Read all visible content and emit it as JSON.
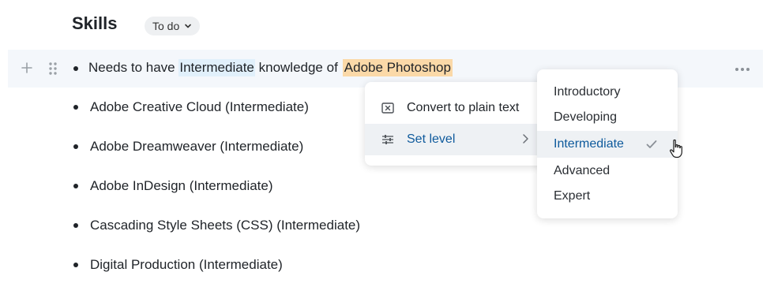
{
  "section": {
    "title": "Skills",
    "status": "To do"
  },
  "main_item": {
    "prefix": "Needs to have",
    "level": "Intermediate",
    "middle": "knowledge of",
    "skill": "Adobe Photoshop"
  },
  "items": [
    {
      "label": "Adobe Creative Cloud (Intermediate)"
    },
    {
      "label": "Adobe Dreamweaver (Intermediate)"
    },
    {
      "label": "Adobe InDesign (Intermediate)"
    },
    {
      "label": "Cascading Style Sheets (CSS) (Intermediate)"
    },
    {
      "label": "Digital Production (Intermediate)"
    }
  ],
  "context_menu": {
    "items": [
      {
        "label": "Convert to plain text",
        "icon": "close-box-icon"
      },
      {
        "label": "Set level",
        "icon": "sliders-icon",
        "active": true
      }
    ]
  },
  "level_menu": {
    "options": [
      {
        "label": "Introductory"
      },
      {
        "label": "Developing"
      },
      {
        "label": "Intermediate",
        "selected": true
      },
      {
        "label": "Advanced"
      },
      {
        "label": "Expert"
      }
    ]
  },
  "colors": {
    "level_highlight": "#e1f0fb",
    "skill_highlight": "#fbd9a8",
    "accent": "#0e5a9c"
  }
}
